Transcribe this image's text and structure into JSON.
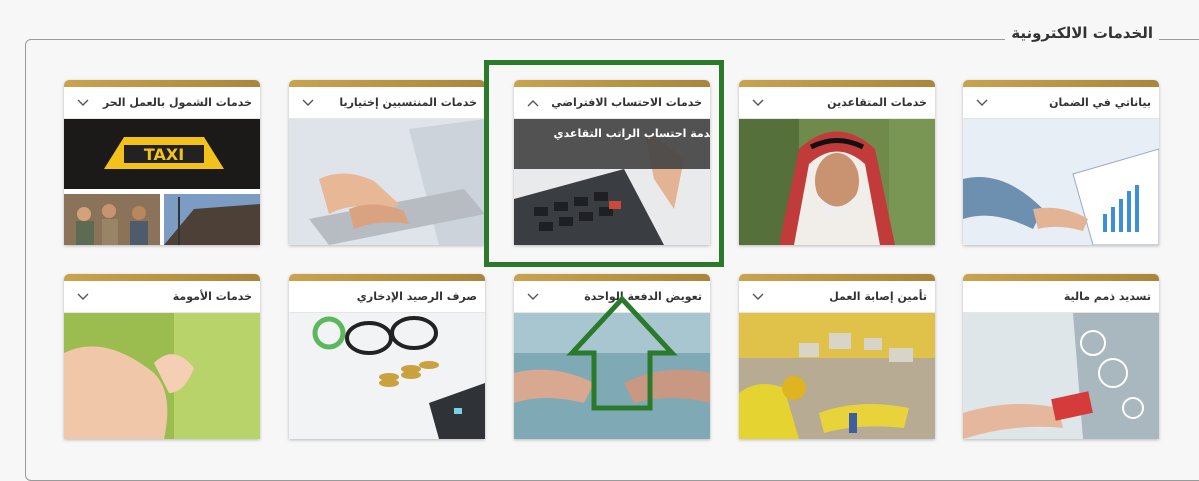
{
  "section": {
    "title": "الخدمات الالكترونية"
  },
  "cards": [
    {
      "label": "خدمات الشمول بالعمل الحر",
      "expanded": false,
      "image": "taxi-and-workers"
    },
    {
      "label": "خدمات المنتسبين إختياريا",
      "expanded": false,
      "image": "laptop-typing"
    },
    {
      "label": "خدمات الاحتساب الافتراضي",
      "expanded": true,
      "image": "calculator",
      "menu_item": "خدمة احتساب الراتب التقاعدي"
    },
    {
      "label": "خدمات المتقاعدين",
      "expanded": false,
      "image": "elderly-man"
    },
    {
      "label": "بياناتي في الضمان",
      "expanded": false,
      "image": "data-charts"
    },
    {
      "label": "خدمات الأمومة",
      "expanded": false,
      "image": "baby-hand"
    },
    {
      "label": "صرف الرصيد الإدخاري",
      "expanded": false,
      "image": "glasses-coins"
    },
    {
      "label": "تعويض الدفعة الواحدة",
      "expanded": false,
      "image": "handshake"
    },
    {
      "label": "تأمين إصابة العمل",
      "expanded": false,
      "image": "work-injury"
    },
    {
      "label": "تسديد ذمم مالية",
      "expanded": false,
      "image": "card-payment"
    }
  ],
  "annotation": {
    "box_color": "#2b7a2b",
    "arrow_color": "#2b7a2b"
  },
  "colors": {
    "gold": "#c9a34f",
    "dropdown_bg": "#464646"
  }
}
